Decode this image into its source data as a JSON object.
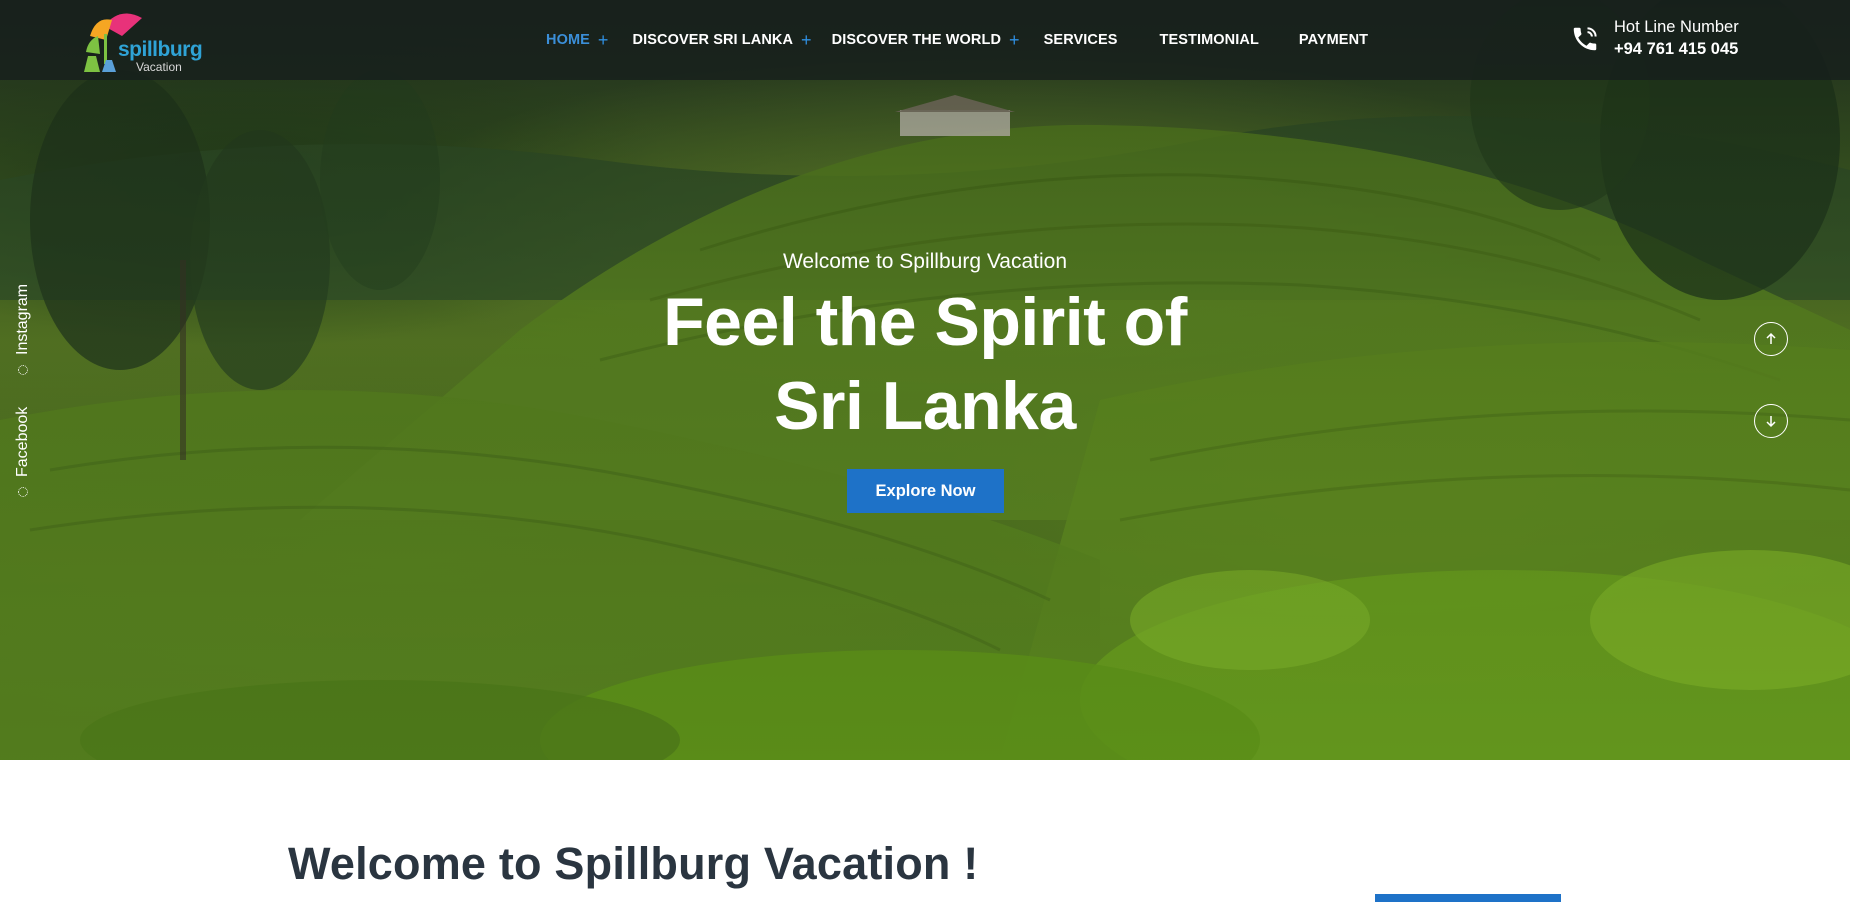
{
  "header": {
    "logo": {
      "brand": "spillburg",
      "sub": "Vacation"
    },
    "nav": [
      {
        "label": "HOME",
        "has_submenu": true,
        "active": true
      },
      {
        "label": "DISCOVER SRI LANKA",
        "has_submenu": true,
        "active": false
      },
      {
        "label": "DISCOVER THE WORLD",
        "has_submenu": true,
        "active": false
      },
      {
        "label": "SERVICES",
        "has_submenu": false,
        "active": false
      },
      {
        "label": "TESTIMONIAL",
        "has_submenu": false,
        "active": false
      },
      {
        "label": "PAYMENT",
        "has_submenu": false,
        "active": false
      }
    ],
    "submenu_icon": "+",
    "hotline": {
      "label": "Hot Line Number",
      "number": "+94 761 415 045",
      "icon": "phone-icon"
    }
  },
  "social": [
    {
      "label": "Instagram"
    },
    {
      "label": "Facebook"
    }
  ],
  "hero": {
    "welcome": "Welcome to Spillburg Vacation",
    "title_line1": "Feel the Spirit of",
    "title_line2": "Sri Lanka",
    "cta": "Explore Now",
    "prev_icon": "arrow-up-icon",
    "next_icon": "arrow-down-icon"
  },
  "section": {
    "heading": "Welcome to Spillburg Vacation !"
  },
  "colors": {
    "accent": "#1e72c8",
    "nav_active": "#3b8fd9",
    "header_bg": "#161e1c",
    "heading_text": "#2a3540"
  }
}
